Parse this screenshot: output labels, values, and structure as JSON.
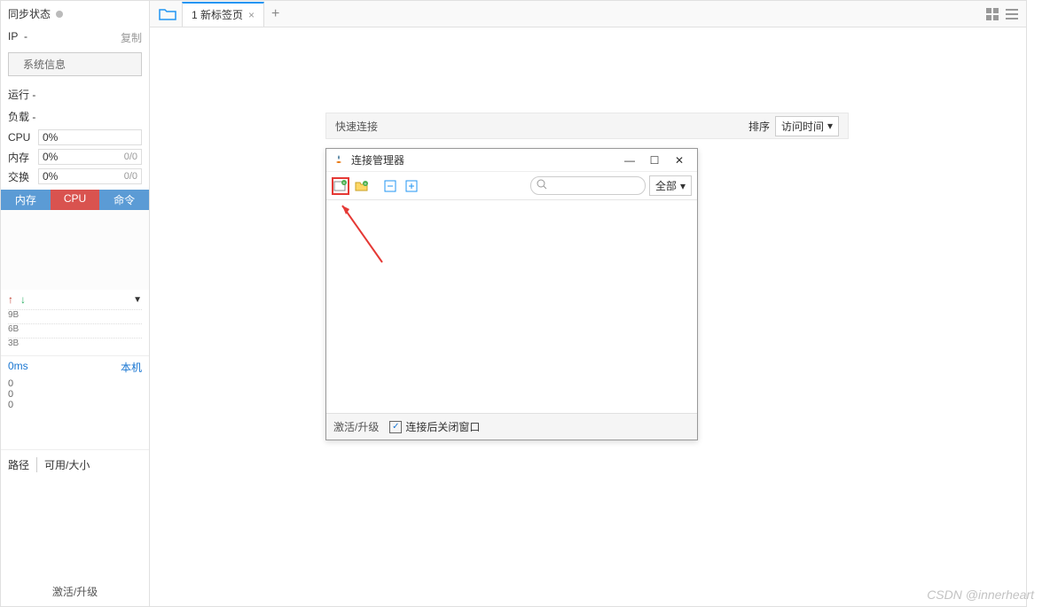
{
  "sidebar": {
    "sync_status_label": "同步状态",
    "ip_label": "IP",
    "ip_value": "-",
    "copy_label": "复制",
    "sysinfo_btn": "系统信息",
    "run_label": "运行 -",
    "load_label": "负载 -",
    "cpu_label": "CPU",
    "cpu_value": "0%",
    "mem_label": "内存",
    "mem_value": "0%",
    "mem_right": "0/0",
    "swap_label": "交换",
    "swap_value": "0%",
    "swap_right": "0/0",
    "tabs": {
      "mem": "内存",
      "cpu": "CPU",
      "cmd": "命令"
    },
    "net_ticks": [
      "9B",
      "6B",
      "3B"
    ],
    "ping_ms": "0ms",
    "ping_host": "本机",
    "ping_vals": [
      "0",
      "0",
      "0"
    ],
    "path_label": "路径",
    "avail_label": "可用/大小",
    "activate_label": "激活/升级"
  },
  "tabbar": {
    "tab1_label": "1 新标签页",
    "view_grid": "grid",
    "view_list": "list"
  },
  "quick": {
    "label": "快速连接",
    "sort_label": "排序",
    "sort_value": "访问时间"
  },
  "dialog": {
    "title": "连接管理器",
    "filter_value": "全部",
    "footer_activate": "激活/升级",
    "footer_close_after": "连接后关闭窗口",
    "search_placeholder": ""
  },
  "watermark": "CSDN @innerheart"
}
